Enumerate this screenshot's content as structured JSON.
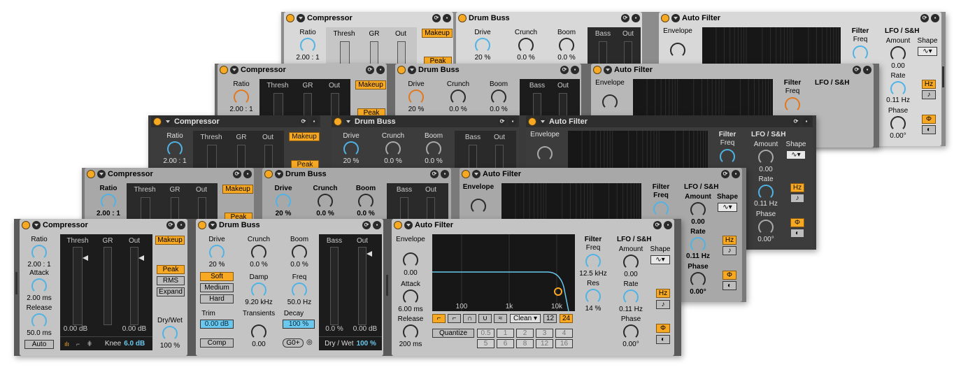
{
  "comp": {
    "title": "Compressor",
    "ratio": "Ratio",
    "ratio_val": "2.00 : 1",
    "attack": "Attack",
    "attack_val": "2.00 ms",
    "release": "Release",
    "release_val": "50.0 ms",
    "auto": "Auto",
    "thresh": "Thresh",
    "gr": "GR",
    "out": "Out",
    "makeup": "Makeup",
    "peak": "Peak",
    "rms": "RMS",
    "expand": "Expand",
    "drywet": "Dry/Wet",
    "drywet_val": "100 %",
    "db1": "0.00 dB",
    "db2": "0.00 dB",
    "knee": "Knee",
    "knee_val": "6.0 dB"
  },
  "drum": {
    "title": "Drum Buss",
    "drive": "Drive",
    "drive_val": "20 %",
    "crunch": "Crunch",
    "crunch_val": "0.0 %",
    "boom": "Boom",
    "boom_val": "0.0 %",
    "soft": "Soft",
    "medium": "Medium",
    "hard": "Hard",
    "damp": "Damp",
    "damp_val": "9.20 kHz",
    "freq": "Freq",
    "freq_val": "50.0 Hz",
    "trim": "Trim",
    "trim_val": "0.00 dB",
    "transients": "Transients",
    "transients_val": "0.00",
    "decay": "Decay",
    "decay_val": "100 %",
    "comp": "Comp",
    "gplus": "G0+",
    "bass": "Bass",
    "out": "Out",
    "bass_val": "0.0 %",
    "out_val": "0.00 dB",
    "drywet": "Dry / Wet",
    "drywet_val": "100 %"
  },
  "af": {
    "title": "Auto Filter",
    "envelope": "Envelope",
    "env_val": "0.00",
    "attack": "Attack",
    "attack_val": "6.00 ms",
    "release": "Release",
    "release_val": "200 ms",
    "tick100": "100",
    "tick1k": "1k",
    "tick10k": "10k",
    "clean": "Clean ▾",
    "n12": "12",
    "n24": "24",
    "quantize": "Quantize",
    "q_vals": [
      "0.5",
      "1",
      "2",
      "3",
      "4",
      "5",
      "6",
      "8",
      "12",
      "16"
    ],
    "filter": "Filter",
    "freq": "Freq",
    "freq_val": "12.5 kHz",
    "res": "Res",
    "res_val": "14 %",
    "lfo": "LFO / S&H",
    "amount": "Amount",
    "shape": "Shape",
    "amount_val": "0.00",
    "rate": "Rate",
    "rate_val": "0.11 Hz",
    "hz": "Hz",
    "phase": "Phase",
    "phase_val": "0.00°",
    "note_icon": "♪",
    "phase_icon": "Φ"
  },
  "layers": [
    {
      "theme": "light",
      "accent": "#4fb3e6"
    },
    {
      "theme": "mid",
      "accent": "#e07820"
    },
    {
      "theme": "dark",
      "accent": "#4fb3e6"
    },
    {
      "theme": "midlight",
      "accent": "#4fb3e6"
    },
    {
      "theme": "front",
      "accent": "#4fb3e6"
    }
  ]
}
